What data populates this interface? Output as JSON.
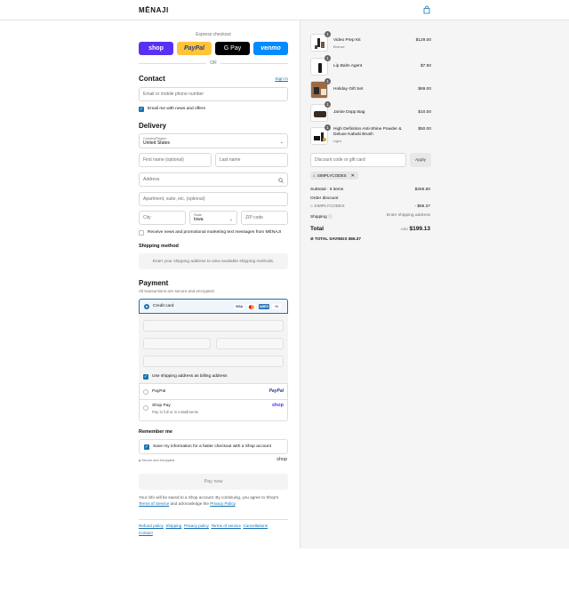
{
  "header": {
    "brand": "MĒNAJI",
    "cart_icon": "bag-icon"
  },
  "express": {
    "label": "Express checkout",
    "buttons": [
      {
        "label": "shop",
        "bg": "#5a31f4",
        "fg": "#ffffff"
      },
      {
        "label": "PayPal",
        "bg": "#ffc439",
        "fg": "#253b80"
      },
      {
        "label": "G Pay",
        "bg": "#000000",
        "fg": "#ffffff"
      },
      {
        "label": "venmo",
        "bg": "#008cff",
        "fg": "#ffffff"
      }
    ],
    "or": "OR"
  },
  "contact": {
    "title": "Contact",
    "sign_in": "Sign in",
    "email_placeholder": "Email or mobile phone number",
    "news_label": "Email me with news and offers"
  },
  "delivery": {
    "title": "Delivery",
    "country_label": "Country/Region",
    "country_value": "United States",
    "first_name": "First name (optional)",
    "last_name": "Last name",
    "address": "Address",
    "apartment": "Apartment, suite, etc. (optional)",
    "city": "City",
    "state_label": "State",
    "state_value": "Iowa",
    "zip": "ZIP code",
    "sms_label": "Receive news and promotional marketing text messages from MĒNAJI"
  },
  "shipping_method": {
    "title": "Shipping method",
    "message": "Enter your shipping address to view available shipping methods."
  },
  "payment": {
    "title": "Payment",
    "subtitle": "All transactions are secure and encrypted.",
    "credit_card": "Credit card",
    "card_badges": [
      "VISA",
      "MC",
      "AMEX",
      "+1"
    ],
    "billing_label": "Use shipping address as billing address",
    "paypal": "PayPal",
    "paypal_logo": "PayPal",
    "shop_pay": "Shop Pay",
    "shop_pay_sub": "Pay in full or in installments",
    "shop_logo": "shop"
  },
  "remember": {
    "title": "Remember me",
    "save_label": "Save my information for a faster checkout with a Shop account",
    "secure": "Secure and encrypted",
    "shop_logo": "shop"
  },
  "pay_now": "Pay now",
  "legal": {
    "line1": "Your info will be saved to a Shop account. By continuing, you agree to Shop’s",
    "tos": "Terms of Service",
    "and": "and acknowledge the",
    "privacy": "Privacy Policy",
    "dot": "."
  },
  "footer_links": [
    "Refund policy",
    "Shipping",
    "Privacy policy",
    "Terms of service",
    "Cancellations",
    "Contact"
  ],
  "summary": {
    "items": [
      {
        "name": "Video Prep Kit",
        "variant": "Bronze",
        "price": "$129.00",
        "qty": "1"
      },
      {
        "name": "Lip Balm Agent",
        "variant": "",
        "price": "$7.50",
        "qty": "1"
      },
      {
        "name": "Holiday Gift Set",
        "variant": "",
        "price": "$69.00",
        "qty": "1"
      },
      {
        "name": "Jamie Dopp Bag",
        "variant": "",
        "price": "$10.00",
        "qty": "1"
      },
      {
        "name": "High Definition Anti-Shine Powder & Deluxe Kabuki Brush",
        "variant": "Light",
        "price": "$50.00",
        "qty": "1"
      }
    ],
    "discount_placeholder": "Discount code or gift card",
    "apply": "Apply",
    "code_tag": "SIMPLYCODES",
    "subtotal_label": "Subtotal · 5 items",
    "subtotal_value": "$265.50",
    "order_discount": "Order discount",
    "discount_code": "SIMPLYCODES",
    "discount_value": "- $66.37",
    "shipping_label": "Shipping",
    "shipping_value": "Enter shipping address",
    "total_label": "Total",
    "currency": "USD",
    "total_value": "$199.13",
    "savings_label": "TOTAL SAVINGS",
    "savings_value": "$66.37"
  }
}
